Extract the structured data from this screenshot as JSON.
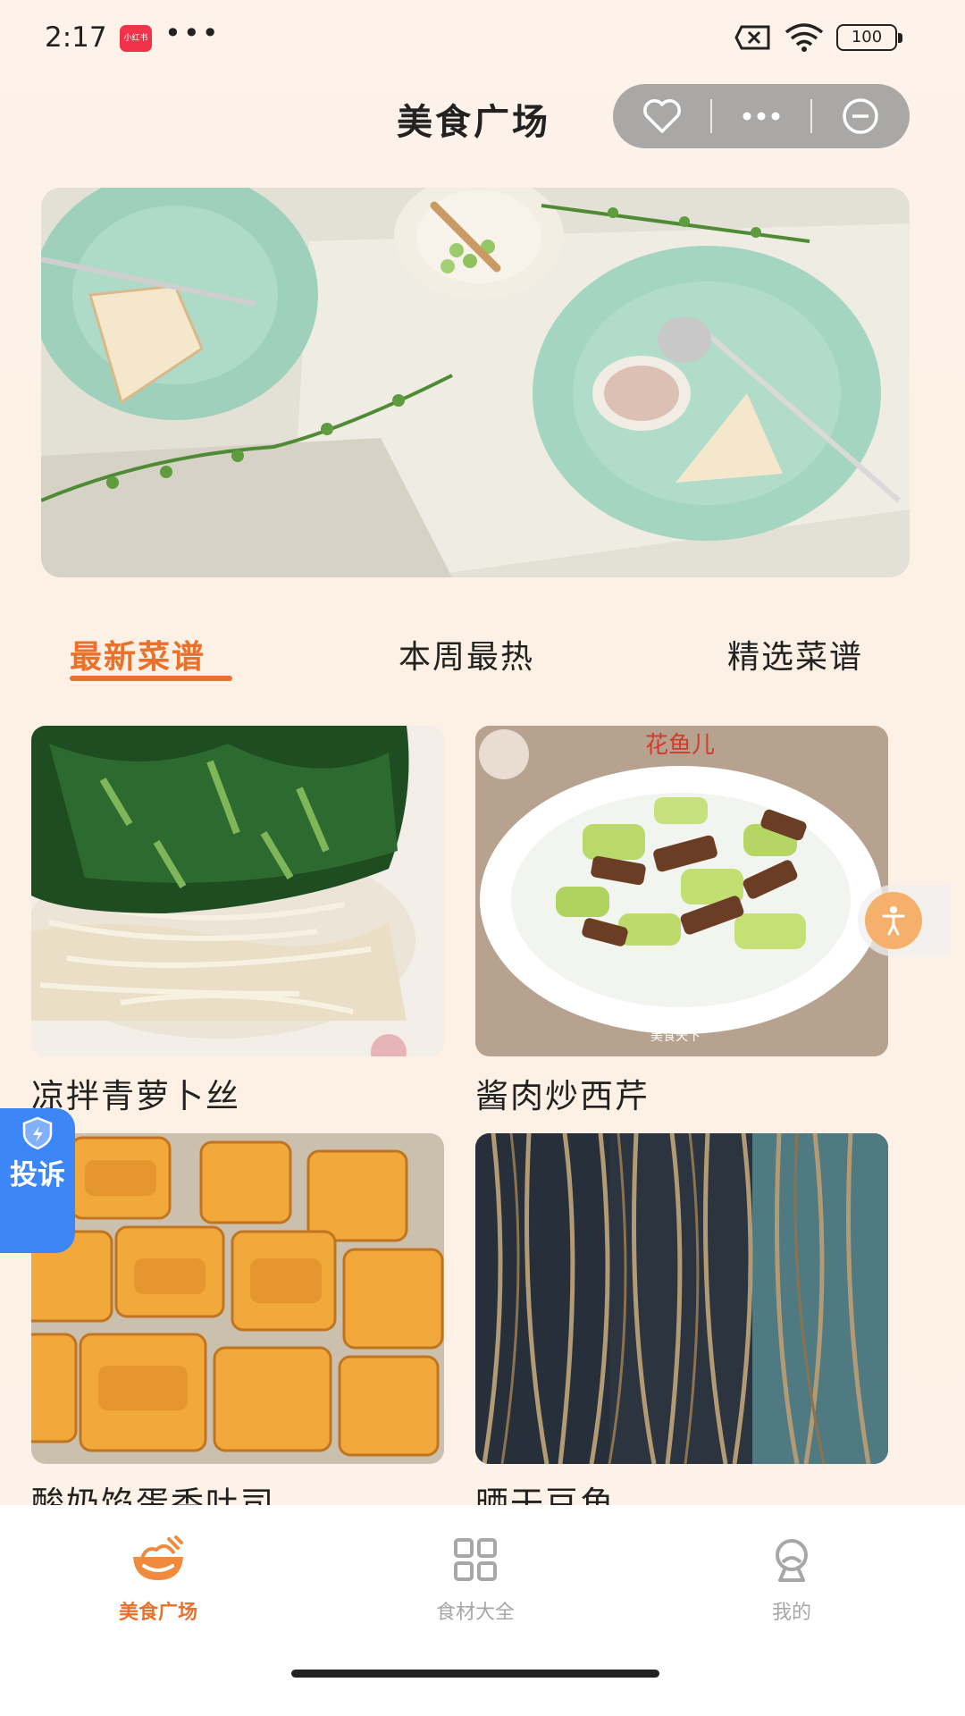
{
  "status_bar": {
    "time": "2:17",
    "app_badge": "小红书",
    "dots": "•••",
    "battery": "100",
    "icons": [
      "close-box-icon",
      "wifi-icon",
      "battery-icon"
    ]
  },
  "header": {
    "title": "美食广场",
    "capsule_icons": [
      "heart-icon",
      "more-icon",
      "minus-circle-icon"
    ]
  },
  "tabs": [
    {
      "label": "最新菜谱",
      "active": true
    },
    {
      "label": "本周最热",
      "active": false
    },
    {
      "label": "精选菜谱",
      "active": false
    }
  ],
  "recipes": [
    {
      "title": "凉拌青萝卜丝"
    },
    {
      "title": "酱肉炒西芹",
      "watermark": "花鱼儿",
      "watermark_bottom": "美食天下"
    },
    {
      "title": "酸奶馅蛋香吐司"
    },
    {
      "title": "晒干豆角"
    }
  ],
  "complaint": {
    "label": "投诉"
  },
  "bottom_nav": [
    {
      "label": "美食广场",
      "icon": "food-bowl-icon",
      "active": true
    },
    {
      "label": "食材大全",
      "icon": "grid-icon",
      "active": false
    },
    {
      "label": "我的",
      "icon": "user-icon",
      "active": false
    }
  ],
  "colors": {
    "accent": "#e8712c",
    "inactive": "#a7a7a7",
    "complaint_blue": "#3d86f7"
  }
}
